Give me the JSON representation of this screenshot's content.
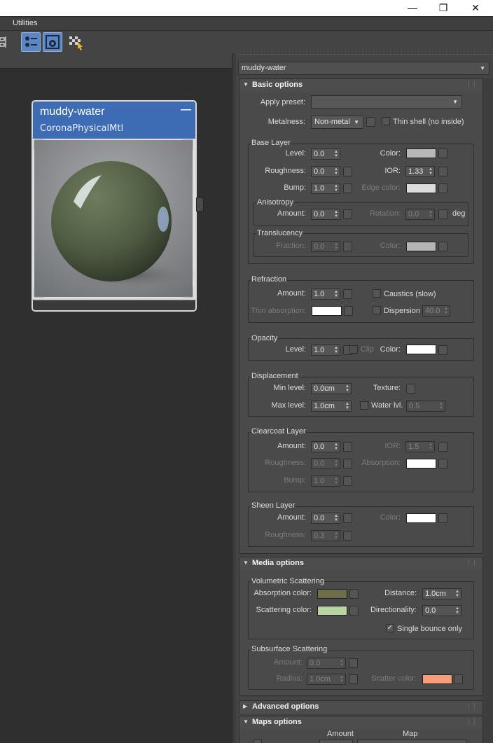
{
  "menubar": {
    "utilities": "Utilities"
  },
  "titlebar": {
    "minimize": "—",
    "maximize": "❐",
    "close": "✕"
  },
  "node": {
    "title": "muddy-water",
    "subtitle": "CoronaPhysicalMtl",
    "collapse": "—"
  },
  "material": {
    "name": "muddy-water"
  },
  "basic": {
    "header": "Basic options",
    "apply_preset": "Apply preset:",
    "metalness": "Metalness:",
    "metalness_value": "Non-metal",
    "thin_shell": "Thin shell (no inside)",
    "base_layer": {
      "title": "Base Layer",
      "level": "Level:",
      "level_v": "0.0",
      "color": "Color:",
      "color_hex": "#b7b7b7",
      "roughness": "Roughness:",
      "roughness_v": "0.0",
      "ior": "IOR:",
      "ior_v": "1.33",
      "bump": "Bump:",
      "bump_v": "1.0",
      "edge_color": "Edge color:",
      "edge_hex": "#dcdcdc"
    },
    "anisotropy": {
      "title": "Anisotropy",
      "amount": "Amount:",
      "amount_v": "0.0",
      "rotation": "Rotation:",
      "rotation_v": "0.0",
      "deg": "deg"
    },
    "translucency": {
      "title": "Translucency",
      "fraction": "Fraction:",
      "fraction_v": "0.0",
      "color": "Color:",
      "color_hex": "#b5b5b5"
    },
    "refraction": {
      "title": "Refraction",
      "amount": "Amount:",
      "amount_v": "1.0",
      "caustics": "Caustics (slow)",
      "thin_absorption": "Thin absorption:",
      "thin_hex": "#ffffff",
      "dispersion": "Dispersion",
      "dispersion_v": "40.0"
    },
    "opacity": {
      "title": "Opacity",
      "level": "Level:",
      "level_v": "1.0",
      "clip": "Clip",
      "color": "Color:",
      "color_hex": "#ffffff"
    },
    "displacement": {
      "title": "Displacement",
      "min": "Min level:",
      "min_v": "0.0cm",
      "texture": "Texture:",
      "max": "Max level:",
      "max_v": "1.0cm",
      "water": "Water lvl.",
      "water_v": "0.5"
    },
    "clearcoat": {
      "title": "Clearcoat Layer",
      "amount": "Amount:",
      "amount_v": "0.0",
      "ior": "IOR:",
      "ior_v": "1.5",
      "roughness": "Roughness:",
      "roughness_v": "0.0",
      "absorption": "Absorption:",
      "abs_hex": "#ffffff",
      "bump": "Bump:",
      "bump_v": "1.0"
    },
    "sheen": {
      "title": "Sheen Layer",
      "amount": "Amount:",
      "amount_v": "0.0",
      "color": "Color:",
      "color_hex": "#ffffff",
      "roughness": "Roughness:",
      "roughness_v": "0.3"
    }
  },
  "media": {
    "header": "Media options",
    "volumetric": {
      "title": "Volumetric Scattering",
      "absorption": "Absorption color:",
      "abs_hex": "#6e6d4c",
      "distance": "Distance:",
      "distance_v": "1.0cm",
      "scattering": "Scattering color:",
      "scat_hex": "#b9d4a3",
      "directionality": "Directionality:",
      "dir_v": "0.0",
      "single_bounce": "Single bounce only"
    },
    "subsurface": {
      "title": "Subsurface Scattering",
      "amount": "Amount:",
      "amount_v": "0.0",
      "radius": "Radius:",
      "radius_v": "1.0cm",
      "scatter": "Scatter color:",
      "scatter_hex": "#f59e7d"
    }
  },
  "advanced": {
    "header": "Advanced options"
  },
  "maps": {
    "header": "Maps options",
    "amount": "Amount",
    "map": "Map"
  }
}
